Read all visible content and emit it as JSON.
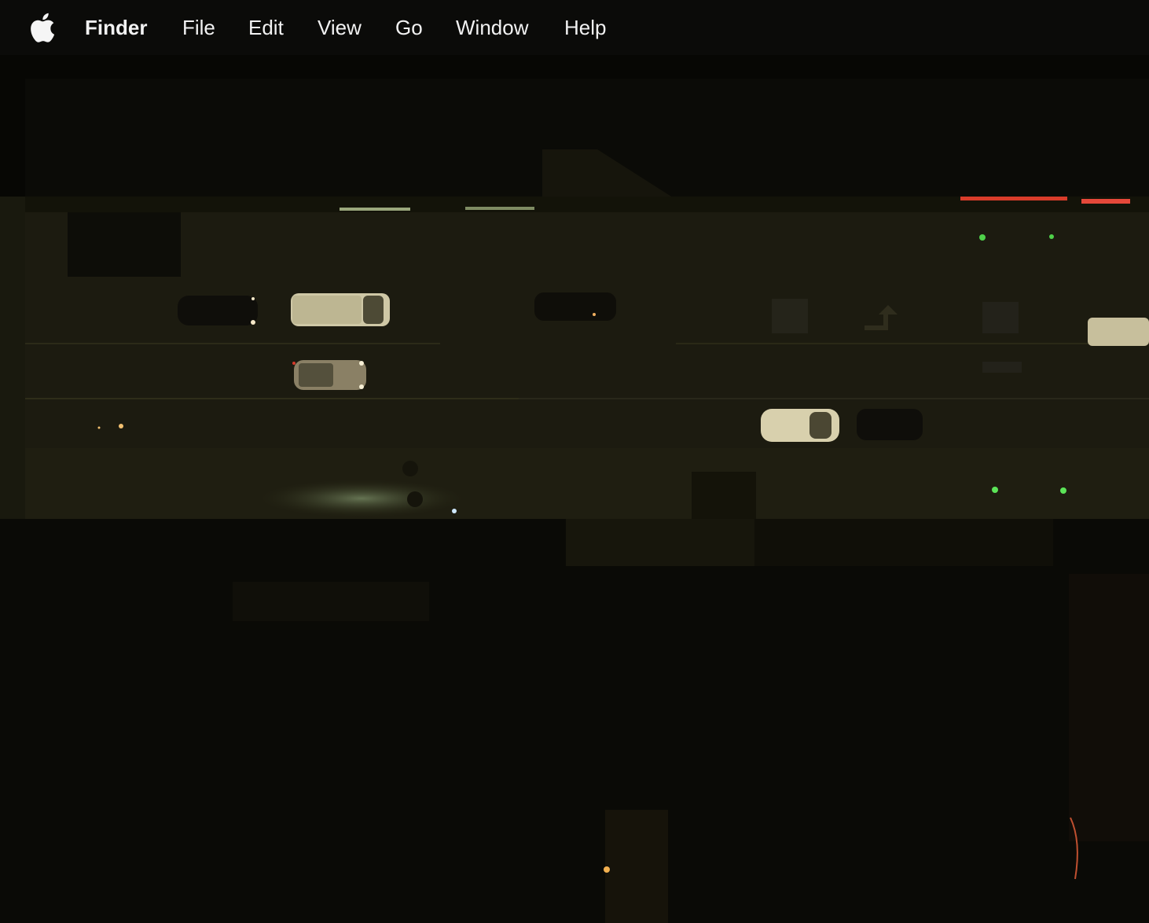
{
  "menubar": {
    "apple_icon": "apple-logo-icon",
    "app_name": "Finder",
    "items": [
      {
        "label": "File"
      },
      {
        "label": "Edit"
      },
      {
        "label": "View"
      },
      {
        "label": "Go"
      },
      {
        "label": "Window"
      },
      {
        "label": "Help"
      }
    ]
  },
  "desktop": {
    "wallpaper": "aerial-night-street-image"
  },
  "colors": {
    "menubar_bg": "#0b0b09",
    "menubar_text": "#f2f2f2"
  }
}
